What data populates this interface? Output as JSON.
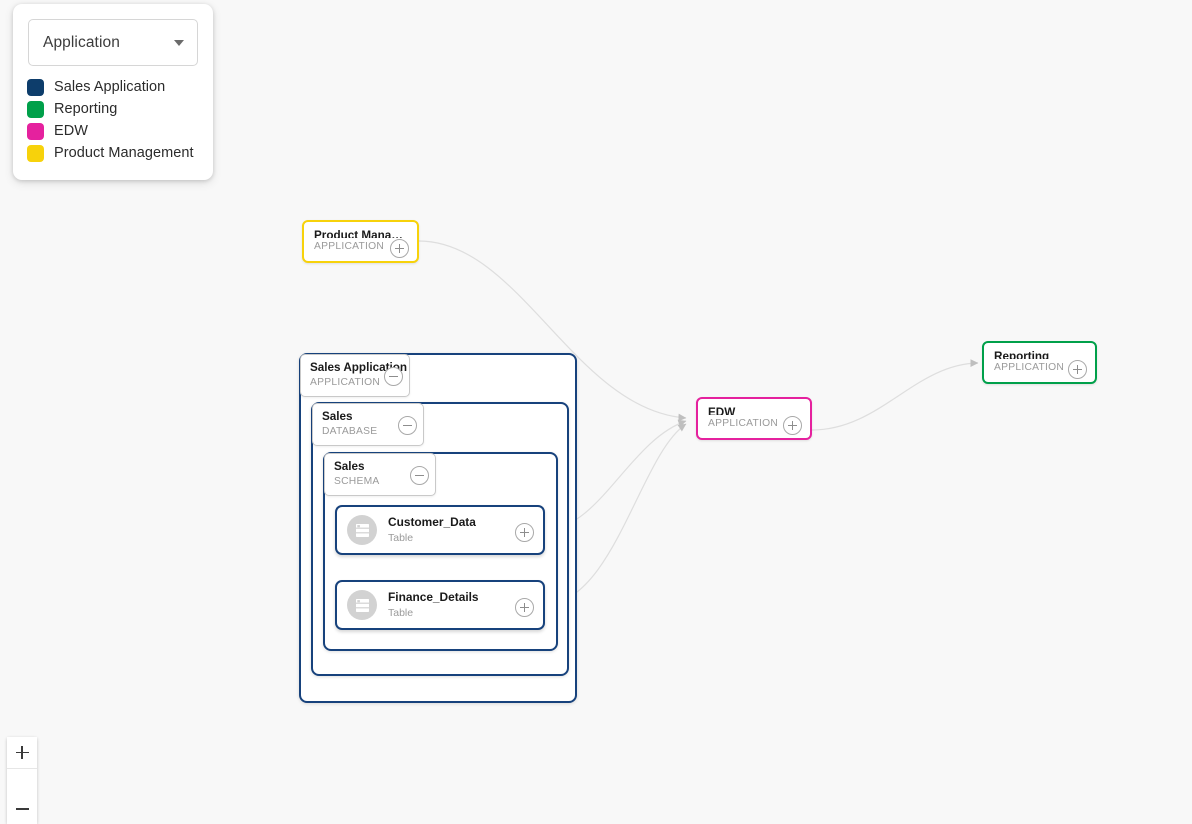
{
  "legend": {
    "selector": {
      "value": "Application",
      "icon": "chevron-down-icon"
    },
    "items": [
      {
        "label": "Sales Application",
        "color": "#0d3d6b"
      },
      {
        "label": "Reporting",
        "color": "#00a04a"
      },
      {
        "label": "EDW",
        "color": "#e5219e"
      },
      {
        "label": "Product Management",
        "color": "#f7d20b"
      }
    ]
  },
  "graph": {
    "nodes": [
      {
        "id": "product-management",
        "title": "Product Managem…",
        "subtitle": "APPLICATION",
        "border_color": "#f7d20b",
        "toggle": "plus"
      },
      {
        "id": "edw",
        "title": "EDW",
        "subtitle": "APPLICATION",
        "border_color": "#e5219e",
        "toggle": "plus"
      },
      {
        "id": "reporting",
        "title": "Reporting",
        "subtitle": "APPLICATION",
        "border_color": "#00a04a",
        "toggle": "plus"
      }
    ],
    "groups": [
      {
        "id": "sales-application",
        "title": "Sales Application",
        "subtitle": "APPLICATION",
        "border_color": "#17427c",
        "toggle": "minus"
      },
      {
        "id": "sales-database",
        "title": "Sales",
        "subtitle": "DATABASE",
        "border_color": "#17427c",
        "toggle": "minus"
      },
      {
        "id": "sales-schema",
        "title": "Sales",
        "subtitle": "SCHEMA",
        "border_color": "#17427c",
        "toggle": "minus"
      }
    ],
    "tables": [
      {
        "id": "customer-data",
        "title": "Customer_Data",
        "subtitle": "Table",
        "icon": "table-icon",
        "toggle": "plus"
      },
      {
        "id": "finance-details",
        "title": "Finance_Details",
        "subtitle": "Table",
        "icon": "table-icon",
        "toggle": "plus"
      }
    ],
    "edges": [
      {
        "from": "product-management",
        "to": "edw"
      },
      {
        "from": "customer-data",
        "to": "edw"
      },
      {
        "from": "finance-details",
        "to": "edw"
      },
      {
        "from": "edw",
        "to": "reporting"
      }
    ],
    "edge_color": "#dcdcdc",
    "arrow_color": "#b9b9b9"
  },
  "zoom_controls": {
    "zoom_in": "+",
    "zoom_out": "−"
  }
}
